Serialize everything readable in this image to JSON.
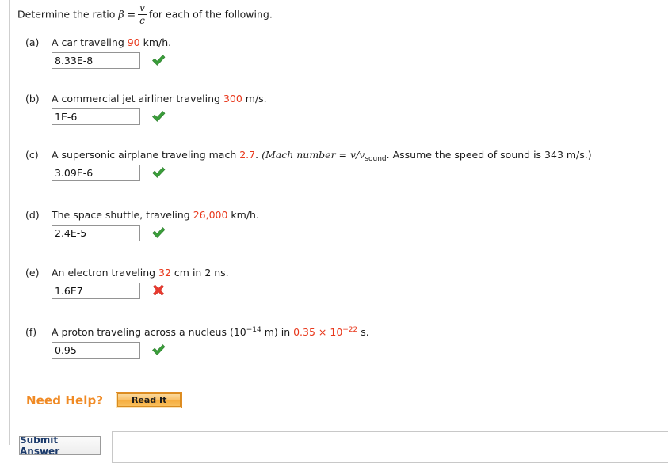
{
  "prompt": {
    "lead": "Determine the ratio",
    "beta": "β",
    "equals": "=",
    "numerator": "v",
    "denominator": "c",
    "trail": "for each of the following."
  },
  "parts": [
    {
      "label": "(a)",
      "text_before": "A car traveling ",
      "highlight": "90",
      "text_after": " km/h.",
      "answer": "8.33E-8",
      "status": "correct",
      "status_icon": "green-check-icon"
    },
    {
      "label": "(b)",
      "text_before": "A commercial jet airliner traveling ",
      "highlight": "300",
      "text_after": " m/s.",
      "answer": "1E-6",
      "status": "correct",
      "status_icon": "green-check-icon"
    },
    {
      "label": "(c)",
      "text_before": "A supersonic airplane traveling mach ",
      "highlight": "2.7",
      "text_after": ". (Mach number = v/v",
      "subscript": "sound",
      "text_after2": ". Assume the speed of sound is 343 m/s.)",
      "answer": "3.09E-6",
      "status": "correct",
      "status_icon": "green-check-icon"
    },
    {
      "label": "(d)",
      "text_before": "The space shuttle, traveling ",
      "highlight": "26,000",
      "text_after": " km/h.",
      "answer": "2.4E-5",
      "status": "correct",
      "status_icon": "green-check-icon"
    },
    {
      "label": "(e)",
      "text_before": "An electron traveling ",
      "highlight": "32",
      "text_after": " cm in 2 ns.",
      "answer": "1.6E7",
      "status": "incorrect",
      "status_icon": "red-x-icon"
    },
    {
      "label": "(f)",
      "text_before": "A proton traveling across a nucleus (10",
      "exponent1": "−14",
      "text_mid": " m) in ",
      "highlight_num": "0.35 × 10",
      "exponent2": "−22",
      "text_after": " s.",
      "answer": "0.95",
      "status": "correct",
      "status_icon": "green-check-icon"
    }
  ],
  "need_help": {
    "label": "Need Help?",
    "button_label": "Read It"
  },
  "footer": {
    "submit_label": "Submit Answer"
  },
  "colors": {
    "highlight_red": "#e8381c",
    "correct_green": "#3a9e3a",
    "incorrect_red": "#e8392e",
    "need_help_orange": "#f08a24"
  }
}
